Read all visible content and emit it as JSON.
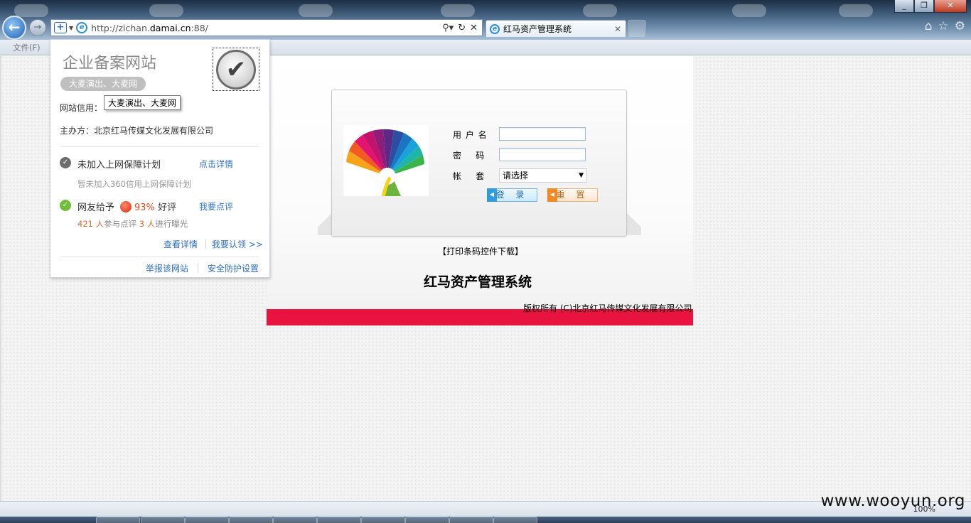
{
  "browser": {
    "url_prefix": "http://zichan.",
    "url_domain": "damai.cn",
    "url_suffix": ":88/",
    "tab_title": "红马资产管理系统",
    "menu_file": "文件(F)",
    "zoom": "100%"
  },
  "security_popup": {
    "title": "企业备案网站",
    "badge": "大麦演出、大麦网",
    "tooltip": "大麦演出、大麦网",
    "site_credit_label": "网站信用：",
    "sponsor": "主办方：北京红马传媒文化发展有限公司",
    "plan_title": "未加入上网保障计划",
    "plan_link": "点击详情",
    "plan_note": "暂未加入360信用上网保障计划",
    "rating_prefix": "网友给予",
    "rating_percent": "93%",
    "rating_suffix": "好评",
    "rating_link": "我要点评",
    "reviewers_count": "421 人",
    "reviewers_label": "参与点评",
    "exposers_count": "3 人",
    "exposers_label": "进行曝光",
    "view_details": "查看详情",
    "claim": "我要认领 >>",
    "report": "举报该网站",
    "protection": "安全防护设置"
  },
  "login": {
    "username_label": "用 户 名",
    "password_label": "密    码",
    "account_label": "帐    套",
    "account_selected": "请选择",
    "login_button": "登 录",
    "reset_button": "重 置",
    "download_link": "【打印条码控件下载】",
    "system_title": "红马资产管理系统",
    "copyright": "版权所有 (C)北京红马传媒文化发展有限公司"
  },
  "watermark": "www.wooyun.org",
  "colors": {
    "accent_red": "#e8143f",
    "link_blue": "#2b6fc4",
    "rating_orange": "#e8682a"
  }
}
